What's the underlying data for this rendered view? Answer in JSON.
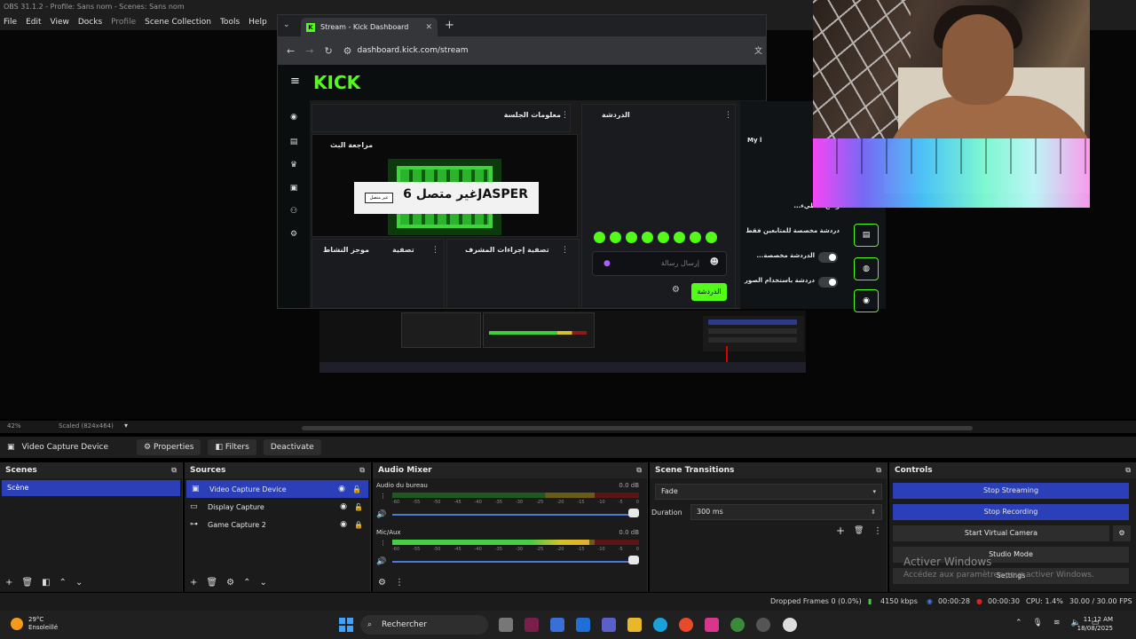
{
  "window": {
    "title": "OBS 31.1.2 - Profile: Sans nom - Scenes: Sans nom"
  },
  "menu": [
    "File",
    "Edit",
    "View",
    "Docks",
    "Profile",
    "Scene Collection",
    "Tools",
    "Help"
  ],
  "browser": {
    "tab_title": "Stream - Kick Dashboard",
    "url": "dashboard.kick.com/stream",
    "logo": "KICK",
    "panels": {
      "session_info": "معلومات الجلسة",
      "stream_preview": "مراجعة البث",
      "chat": "الدردشة",
      "activity_feed": "موجز النشاط",
      "filter1": "تصفية",
      "mod_actions": "إجراءات المشرف",
      "filter2": "تصفية"
    },
    "offline_text": "غير متصل 6JASPER",
    "offline_badge": "غير متصل",
    "chat_placeholder": "إرسال رسالة",
    "chat_send": "الدردشة",
    "right_panel": {
      "myl": "My l",
      "row1": "...وضع البطيء",
      "row2": "دردشة مخصصة للمتابعين فقط",
      "row3": "...الدردشة مخصصة",
      "row4": "دردشة باستخدام الصور"
    }
  },
  "preview_status": {
    "zoom": "42%",
    "scaled": "Scaled (824x464)"
  },
  "source_toolbar": {
    "source_name": "Video Capture Device",
    "properties": "Properties",
    "filters": "Filters",
    "deactivate": "Deactivate"
  },
  "scenes": {
    "title": "Scenes",
    "items": [
      "Scène"
    ]
  },
  "sources": {
    "title": "Sources",
    "items": [
      "Video Capture Device",
      "Display Capture",
      "Game Capture 2"
    ]
  },
  "mixer": {
    "title": "Audio Mixer",
    "ticks": [
      "-60",
      "-55",
      "-50",
      "-45",
      "-40",
      "-35",
      "-30",
      "-25",
      "-20",
      "-15",
      "-10",
      "-5",
      "0"
    ],
    "channels": [
      {
        "name": "Audio du bureau",
        "db": "0.0 dB",
        "level": 0
      },
      {
        "name": "Mic/Aux",
        "db": "0.0 dB",
        "level": 0.8
      }
    ]
  },
  "transitions": {
    "title": "Scene Transitions",
    "type": "Fade",
    "duration_label": "Duration",
    "duration": "300 ms"
  },
  "controls": {
    "title": "Controls",
    "stop_streaming": "Stop Streaming",
    "stop_recording": "Stop Recording",
    "start_virtual_camera": "Start Virtual Camera",
    "studio_mode": "Studio Mode",
    "settings": "Settings"
  },
  "watermark": {
    "line1": "Activer Windows",
    "line2": "Accédez aux paramètres pour activer Windows."
  },
  "status": {
    "dropped": "Dropped Frames 0 (0.0%)",
    "bitrate": "4150 kbps",
    "stream_time": "00:00:28",
    "rec_time": "00:00:30",
    "cpu": "CPU: 1.4%",
    "fps": "30.00 / 30.00 FPS"
  },
  "taskbar": {
    "temp": "29°C",
    "weather": "Ensoleillé",
    "search": "Rechercher",
    "time": "11:12 AM",
    "date": "18/08/2025"
  },
  "colors": {
    "kick_green": "#53fc18",
    "obs_blue": "#2b3fb8"
  }
}
